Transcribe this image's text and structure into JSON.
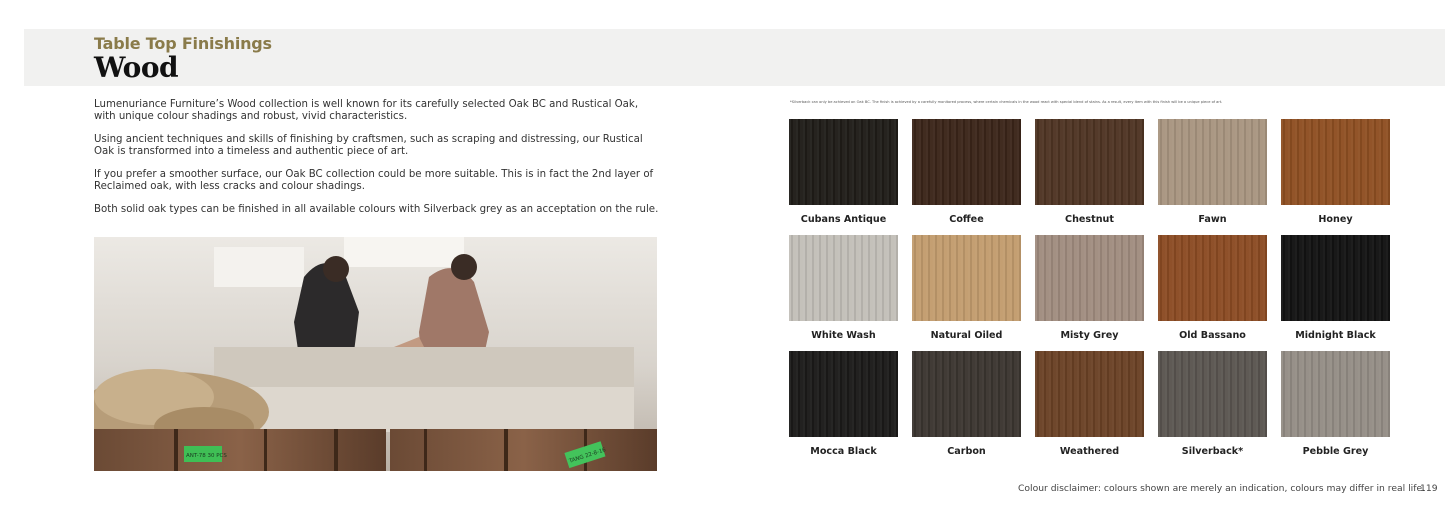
{
  "header": {
    "subtitle": "Table Top Finishings",
    "title": "Wood"
  },
  "paragraphs": [
    "Lumenuriance Furniture’s Wood collection is well known for its carefully selected Oak BC and Rustical Oak, with unique colour shadings and robust, vivid characteristics.",
    "Using ancient techniques and skills of finishing by craftsmen, such as scraping and distressing, our Rustical Oak is transformed into a timeless and authentic piece of art.",
    "If you prefer a smoother surface, our Oak BC collection could be more suitable. This is in fact the 2nd layer of Reclaimed oak, with less cracks and colour shadings.",
    "Both solid oak types can be finished in all available colours with Silverback grey as an acceptation on the rule."
  ],
  "fine_print": "*Silverback can only be achieved on Oak BC. The finish is achieved by a carefully monitored process, where certain chemicals in the wood react with special blend of stains. As a result, every item with this finish will be a unique piece of art.",
  "swatches": [
    {
      "name": "Cubans Antique",
      "color": "#1f1c18"
    },
    {
      "name": "Coffee",
      "color": "#3b2519"
    },
    {
      "name": "Chestnut",
      "color": "#4e3423"
    },
    {
      "name": "Fawn",
      "color": "#a89580"
    },
    {
      "name": "Honey",
      "color": "#8e4f22"
    },
    {
      "name": "White Wash",
      "color": "#c2bfb8"
    },
    {
      "name": "Natural Oiled",
      "color": "#c29c6e"
    },
    {
      "name": "Misty Grey",
      "color": "#a08c7f"
    },
    {
      "name": "Old Bassano",
      "color": "#8b4b23"
    },
    {
      "name": "Midnight Black",
      "color": "#121212"
    },
    {
      "name": "Mocca Black",
      "color": "#1b1a19"
    },
    {
      "name": "Carbon",
      "color": "#3b3530"
    },
    {
      "name": "Weathered",
      "color": "#6a4125"
    },
    {
      "name": "Silverback*",
      "color": "#5a5550"
    },
    {
      "name": "Pebble Grey",
      "color": "#948d85"
    }
  ],
  "photo": {
    "tag_left": "ANT-78 30 PCS",
    "tag_right": "TANG 22-8-16"
  },
  "footer": {
    "disclaimer": "Colour disclaimer: colours shown are merely an indication, colours may differ in real life.",
    "page_number": "119"
  }
}
